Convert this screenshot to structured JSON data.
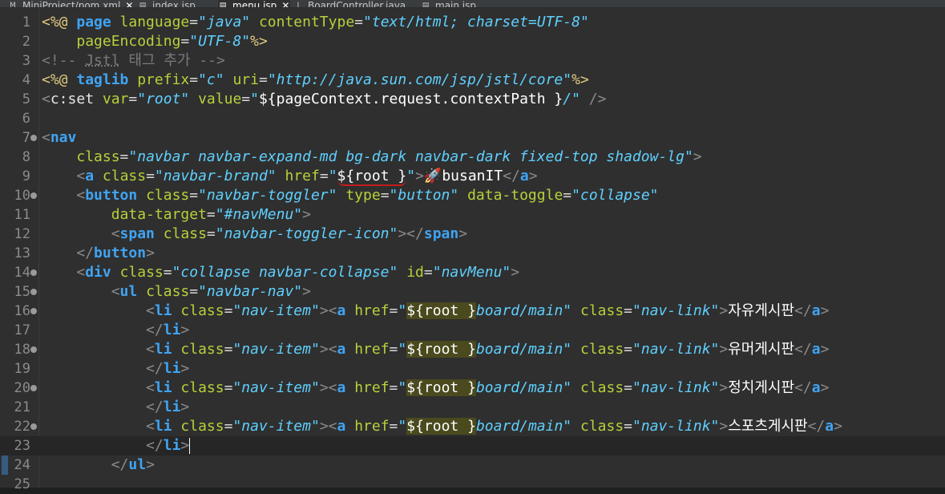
{
  "tabs": [
    {
      "name": "MiniProject/pom.xml",
      "icon": "xml-file-icon",
      "icon_glyph": "M",
      "close": "✕",
      "active": false
    },
    {
      "name": "index.jsp",
      "icon": "jsp-file-icon",
      "icon_glyph": "▤",
      "close": "",
      "active": false
    },
    {
      "name": "menu.jsp",
      "icon": "jsp-file-icon",
      "icon_glyph": "▤",
      "close": "✕",
      "active": true
    },
    {
      "name": "BoardController.java",
      "icon": "java-file-icon",
      "icon_glyph": "J",
      "close": "",
      "active": false
    },
    {
      "name": "main.jsp",
      "icon": "jsp-file-icon",
      "icon_glyph": "▤",
      "close": "",
      "active": false
    }
  ],
  "colors": {
    "background": "#2f2f2f",
    "tag_name": "#3fa4f4",
    "attribute": "#b6d13b",
    "string": "#5fd0ff",
    "comment": "#7a7a7a",
    "jsp_delimiter": "#e0c97f",
    "line_number": "#8b8b8b"
  },
  "editor": {
    "current_line": 23,
    "lines": [
      {
        "n": "1",
        "fold": false,
        "tokens": [
          [
            "delim",
            "<%@ "
          ],
          [
            "kw",
            "page "
          ],
          [
            "attr",
            "language"
          ],
          [
            "eq",
            "="
          ],
          [
            "str",
            "\"java\" "
          ],
          [
            "attr",
            "contentType"
          ],
          [
            "eq",
            "="
          ],
          [
            "str",
            "\"text/html; charset=UTF-8\""
          ]
        ]
      },
      {
        "n": "2",
        "fold": false,
        "tokens": [
          [
            "txt",
            "    "
          ],
          [
            "attr",
            "pageEncoding"
          ],
          [
            "eq",
            "="
          ],
          [
            "str",
            "\"UTF-8\""
          ],
          [
            "delim",
            "%>"
          ]
        ]
      },
      {
        "n": "3",
        "fold": false,
        "tokens": [
          [
            "cm",
            "<!-- "
          ],
          [
            "cmsq",
            "Jstl"
          ],
          [
            "cm",
            " 태그 추가 -->"
          ]
        ]
      },
      {
        "n": "4",
        "fold": false,
        "tokens": [
          [
            "delim",
            "<%@ "
          ],
          [
            "kw",
            "taglib "
          ],
          [
            "attr",
            "prefix"
          ],
          [
            "eq",
            "="
          ],
          [
            "str",
            "\"c\" "
          ],
          [
            "attr",
            "uri"
          ],
          [
            "eq",
            "="
          ],
          [
            "str",
            "\"http://java.sun.com/jsp/jstl/core\""
          ],
          [
            "delim",
            "%>"
          ]
        ]
      },
      {
        "n": "5",
        "fold": false,
        "tokens": [
          [
            "br",
            "<"
          ],
          [
            "el",
            "c:set "
          ],
          [
            "attr",
            "var"
          ],
          [
            "eq",
            "="
          ],
          [
            "str",
            "\"root\" "
          ],
          [
            "attr",
            "value"
          ],
          [
            "eq",
            "="
          ],
          [
            "str",
            "\""
          ],
          [
            "txt",
            "${pageContext.request.contextPath }"
          ],
          [
            "str",
            "/\" "
          ],
          [
            "br",
            "/>"
          ]
        ]
      },
      {
        "n": "6",
        "fold": false,
        "tokens": []
      },
      {
        "n": "7",
        "fold": true,
        "tokens": [
          [
            "br",
            "<"
          ],
          [
            "kw",
            "nav"
          ]
        ]
      },
      {
        "n": "8",
        "fold": false,
        "tokens": [
          [
            "txt",
            "    "
          ],
          [
            "attr",
            "class"
          ],
          [
            "eq",
            "="
          ],
          [
            "str",
            "\"navbar navbar-expand-md bg-dark navbar-dark fixed-top shadow-lg\""
          ],
          [
            "br",
            ">"
          ]
        ]
      },
      {
        "n": "9",
        "fold": false,
        "tokens": [
          [
            "txt",
            "    "
          ],
          [
            "br",
            "<"
          ],
          [
            "kw",
            "a "
          ],
          [
            "attr",
            "class"
          ],
          [
            "eq",
            "="
          ],
          [
            "str",
            "\"navbar-brand\" "
          ],
          [
            "attr",
            "href"
          ],
          [
            "eq",
            "="
          ],
          [
            "str",
            "\""
          ],
          [
            "sq",
            "${root }"
          ],
          [
            "str",
            "\""
          ],
          [
            "br",
            ">"
          ],
          [
            "txt",
            "🚀busanIT"
          ],
          [
            "br",
            "</"
          ],
          [
            "kw",
            "a"
          ],
          [
            "br",
            ">"
          ]
        ]
      },
      {
        "n": "10",
        "fold": true,
        "tokens": [
          [
            "txt",
            "    "
          ],
          [
            "br",
            "<"
          ],
          [
            "kw",
            "button "
          ],
          [
            "attr",
            "class"
          ],
          [
            "eq",
            "="
          ],
          [
            "str",
            "\"navbar-toggler\" "
          ],
          [
            "attr",
            "type"
          ],
          [
            "eq",
            "="
          ],
          [
            "str",
            "\"button\" "
          ],
          [
            "attr",
            "data-toggle"
          ],
          [
            "eq",
            "="
          ],
          [
            "str",
            "\"collapse\""
          ]
        ]
      },
      {
        "n": "11",
        "fold": false,
        "tokens": [
          [
            "txt",
            "        "
          ],
          [
            "attr",
            "data-target"
          ],
          [
            "eq",
            "="
          ],
          [
            "str",
            "\"#navMenu\""
          ],
          [
            "br",
            ">"
          ]
        ]
      },
      {
        "n": "12",
        "fold": false,
        "tokens": [
          [
            "txt",
            "        "
          ],
          [
            "br",
            "<"
          ],
          [
            "kw",
            "span "
          ],
          [
            "attr",
            "class"
          ],
          [
            "eq",
            "="
          ],
          [
            "str",
            "\"navbar-toggler-icon\""
          ],
          [
            "br",
            "></"
          ],
          [
            "kw",
            "span"
          ],
          [
            "br",
            ">"
          ]
        ]
      },
      {
        "n": "13",
        "fold": false,
        "tokens": [
          [
            "txt",
            "    "
          ],
          [
            "br",
            "</"
          ],
          [
            "kw",
            "button"
          ],
          [
            "br",
            ">"
          ]
        ]
      },
      {
        "n": "14",
        "fold": true,
        "tokens": [
          [
            "txt",
            "    "
          ],
          [
            "br",
            "<"
          ],
          [
            "kw",
            "div "
          ],
          [
            "attr",
            "class"
          ],
          [
            "eq",
            "="
          ],
          [
            "str",
            "\"collapse navbar-collapse\" "
          ],
          [
            "attr",
            "id"
          ],
          [
            "eq",
            "="
          ],
          [
            "str",
            "\"navMenu\""
          ],
          [
            "br",
            ">"
          ]
        ]
      },
      {
        "n": "15",
        "fold": true,
        "tokens": [
          [
            "txt",
            "        "
          ],
          [
            "br",
            "<"
          ],
          [
            "kw",
            "ul "
          ],
          [
            "attr",
            "class"
          ],
          [
            "eq",
            "="
          ],
          [
            "str",
            "\"navbar-nav\""
          ],
          [
            "br",
            ">"
          ]
        ]
      },
      {
        "n": "16",
        "fold": true,
        "tokens": [
          [
            "txt",
            "            "
          ],
          [
            "br",
            "<"
          ],
          [
            "kw",
            "li "
          ],
          [
            "attr",
            "class"
          ],
          [
            "eq",
            "="
          ],
          [
            "str",
            "\"nav-item\""
          ],
          [
            "br",
            "><"
          ],
          [
            "kw",
            "a "
          ],
          [
            "attr",
            "href"
          ],
          [
            "eq",
            "="
          ],
          [
            "str",
            "\""
          ],
          [
            "hl",
            "${root }"
          ],
          [
            "str",
            "board/main\" "
          ],
          [
            "attr",
            "class"
          ],
          [
            "eq",
            "="
          ],
          [
            "str",
            "\"nav-link\""
          ],
          [
            "br",
            ">"
          ],
          [
            "txt",
            "자유게시판"
          ],
          [
            "br",
            "</"
          ],
          [
            "kw",
            "a"
          ],
          [
            "br",
            ">"
          ]
        ]
      },
      {
        "n": "17",
        "fold": false,
        "tokens": [
          [
            "txt",
            "            "
          ],
          [
            "br",
            "</"
          ],
          [
            "kw",
            "li"
          ],
          [
            "br",
            ">"
          ]
        ]
      },
      {
        "n": "18",
        "fold": true,
        "tokens": [
          [
            "txt",
            "            "
          ],
          [
            "br",
            "<"
          ],
          [
            "kw",
            "li "
          ],
          [
            "attr",
            "class"
          ],
          [
            "eq",
            "="
          ],
          [
            "str",
            "\"nav-item\""
          ],
          [
            "br",
            "><"
          ],
          [
            "kw",
            "a "
          ],
          [
            "attr",
            "href"
          ],
          [
            "eq",
            "="
          ],
          [
            "str",
            "\""
          ],
          [
            "hl",
            "${root }"
          ],
          [
            "str",
            "board/main\" "
          ],
          [
            "attr",
            "class"
          ],
          [
            "eq",
            "="
          ],
          [
            "str",
            "\"nav-link\""
          ],
          [
            "br",
            ">"
          ],
          [
            "txt",
            "유머게시판"
          ],
          [
            "br",
            "</"
          ],
          [
            "kw",
            "a"
          ],
          [
            "br",
            ">"
          ]
        ]
      },
      {
        "n": "19",
        "fold": false,
        "tokens": [
          [
            "txt",
            "            "
          ],
          [
            "br",
            "</"
          ],
          [
            "kw",
            "li"
          ],
          [
            "br",
            ">"
          ]
        ]
      },
      {
        "n": "20",
        "fold": true,
        "tokens": [
          [
            "txt",
            "            "
          ],
          [
            "br",
            "<"
          ],
          [
            "kw",
            "li "
          ],
          [
            "attr",
            "class"
          ],
          [
            "eq",
            "="
          ],
          [
            "str",
            "\"nav-item\""
          ],
          [
            "br",
            "><"
          ],
          [
            "kw",
            "a "
          ],
          [
            "attr",
            "href"
          ],
          [
            "eq",
            "="
          ],
          [
            "str",
            "\""
          ],
          [
            "hl",
            "${root }"
          ],
          [
            "str",
            "board/main\" "
          ],
          [
            "attr",
            "class"
          ],
          [
            "eq",
            "="
          ],
          [
            "str",
            "\"nav-link\""
          ],
          [
            "br",
            ">"
          ],
          [
            "txt",
            "정치게시판"
          ],
          [
            "br",
            "</"
          ],
          [
            "kw",
            "a"
          ],
          [
            "br",
            ">"
          ]
        ]
      },
      {
        "n": "21",
        "fold": false,
        "tokens": [
          [
            "txt",
            "            "
          ],
          [
            "br",
            "</"
          ],
          [
            "kw",
            "li"
          ],
          [
            "br",
            ">"
          ]
        ]
      },
      {
        "n": "22",
        "fold": true,
        "tokens": [
          [
            "txt",
            "            "
          ],
          [
            "br",
            "<"
          ],
          [
            "kw",
            "li "
          ],
          [
            "attr",
            "class"
          ],
          [
            "eq",
            "="
          ],
          [
            "str",
            "\"nav-item\""
          ],
          [
            "br",
            "><"
          ],
          [
            "kw",
            "a "
          ],
          [
            "attr",
            "href"
          ],
          [
            "eq",
            "="
          ],
          [
            "str",
            "\""
          ],
          [
            "hl",
            "${root }"
          ],
          [
            "str",
            "board/main\" "
          ],
          [
            "attr",
            "class"
          ],
          [
            "eq",
            "="
          ],
          [
            "str",
            "\"nav-link\""
          ],
          [
            "br",
            ">"
          ],
          [
            "txt",
            "스포츠게시판"
          ],
          [
            "br",
            "</"
          ],
          [
            "kw",
            "a"
          ],
          [
            "br",
            ">"
          ]
        ]
      },
      {
        "n": "23",
        "fold": false,
        "tokens": [
          [
            "txt",
            "            "
          ],
          [
            "br",
            "</"
          ],
          [
            "kw",
            "li"
          ],
          [
            "br",
            ">"
          ],
          [
            "cursor",
            ""
          ]
        ]
      },
      {
        "n": "24",
        "fold": false,
        "tokens": [
          [
            "txt",
            "        "
          ],
          [
            "br",
            "</"
          ],
          [
            "kw",
            "ul"
          ],
          [
            "br",
            ">"
          ]
        ]
      },
      {
        "n": "25",
        "fold": false,
        "tokens": []
      }
    ]
  }
}
